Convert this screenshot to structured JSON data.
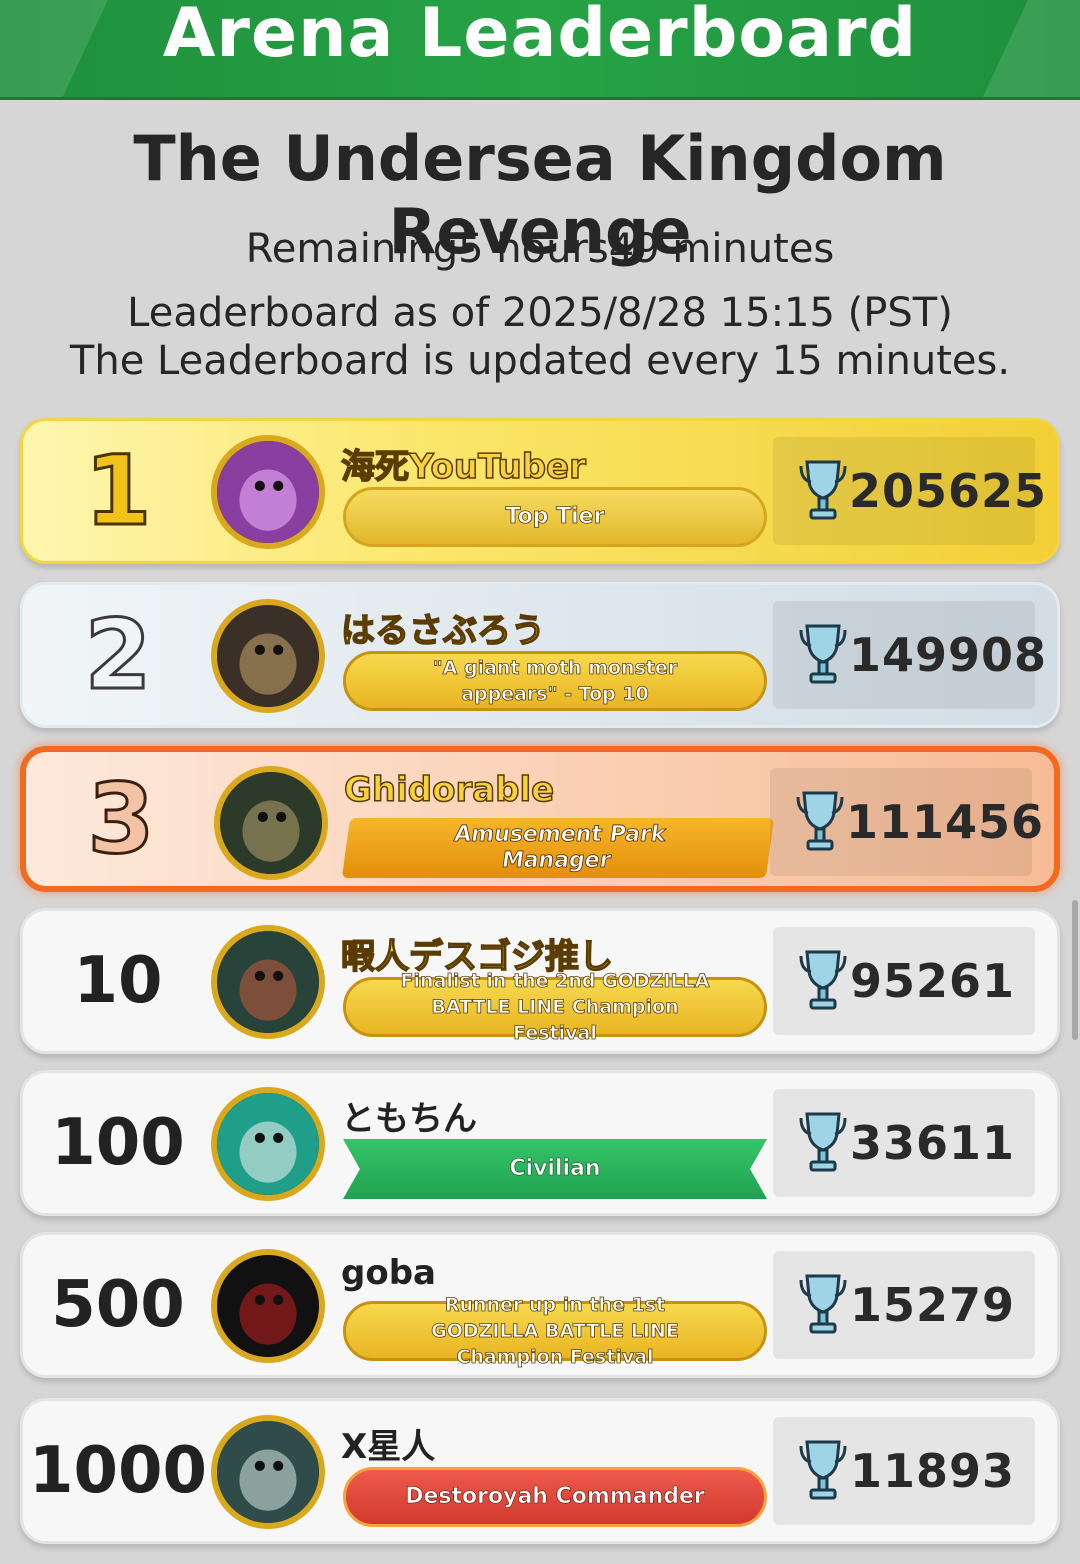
{
  "header": {
    "title": "Arena Leaderboard"
  },
  "event": {
    "title": "The Undersea Kingdom Revenge",
    "remaining": "Remaining5 hours49 minutes",
    "as_of": "Leaderboard as of 2025/8/28 15:15 (PST)",
    "update_note": "The Leaderboard is updated every 15 minutes."
  },
  "score_icon": "trophy-icon",
  "rows": [
    {
      "rank": "1",
      "name": "海死YouTuber",
      "title": "Top Tier",
      "score": "205625",
      "style": "gold",
      "badge": "gold-badge"
    },
    {
      "rank": "2",
      "name": "はるさぶろう",
      "title": "\"A giant moth monster appears\" - Top 10",
      "score": "149908",
      "style": "silver",
      "badge": "yellow-badge"
    },
    {
      "rank": "3",
      "name": "Ghidorable",
      "title": "Amusement Park Manager",
      "score": "111456",
      "style": "bronze",
      "badge": "orange-badge"
    },
    {
      "rank": "10",
      "name": "暇人デスゴジ推し",
      "title": "Finalist in the 2nd GODZILLA BATTLE LINE Champion Festival",
      "score": "95261",
      "style": "plain",
      "badge": "yellow-badge"
    },
    {
      "rank": "100",
      "name": "ともちん",
      "title": "Civilian",
      "score": "33611",
      "style": "plain",
      "badge": "green-badge"
    },
    {
      "rank": "500",
      "name": "goba",
      "title": "Runner up in the 1st GODZILLA BATTLE LINE Champion Festival",
      "score": "15279",
      "style": "plain",
      "badge": "yellow-badge"
    },
    {
      "rank": "1000",
      "name": "X星人",
      "title": "Destoroyah Commander",
      "score": "11893",
      "style": "plain",
      "badge": "red-badge"
    }
  ]
}
